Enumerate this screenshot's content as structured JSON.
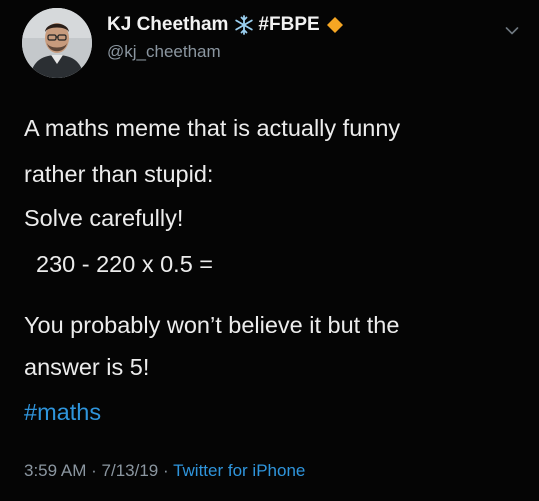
{
  "author": {
    "name": "KJ Cheetham",
    "hashtag_badge": "#FBPE",
    "handle": "@kj_cheetham",
    "badge_icons": [
      "snowflake-icon",
      "orange-diamond-icon"
    ],
    "badge_colors": {
      "snowflake": "#9bd0f0",
      "diamond": "#f5a623"
    }
  },
  "tweet": {
    "line1": "A maths meme that is actually funny",
    "line2": "rather than stupid:",
    "line3": "Solve carefully!",
    "line4": "230 - 220 x 0.5 =",
    "line5": "You probably won’t believe it but the",
    "line6": "answer is 5!",
    "hashtag": "#maths"
  },
  "meta": {
    "time": "3:59 AM",
    "separator": "·",
    "date": "7/13/19",
    "source": "Twitter for iPhone"
  },
  "colors": {
    "background": "#050505",
    "link": "#2f95dc",
    "secondary_text": "#8b96a0"
  }
}
